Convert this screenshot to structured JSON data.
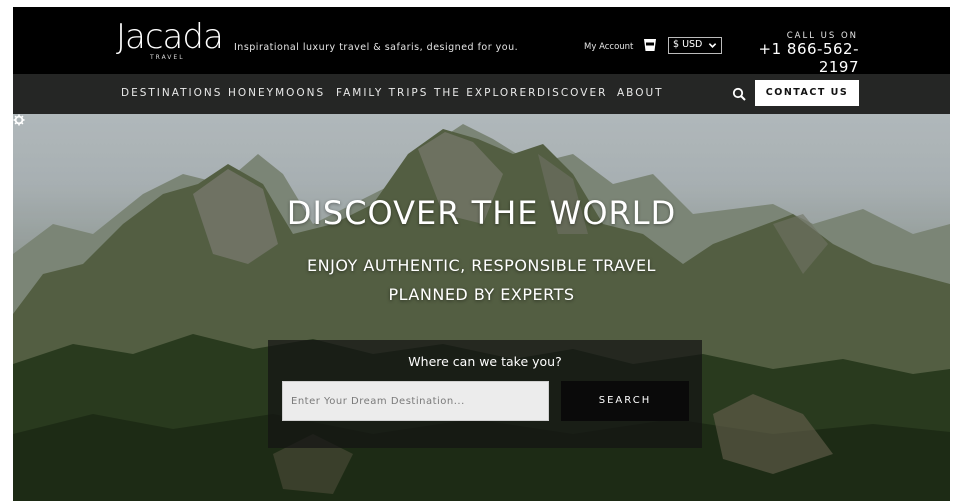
{
  "brand": {
    "logo_text": "Jacada",
    "logo_subtext": "TRAVEL",
    "tagline": "Inspirational luxury travel & safaris, designed for you."
  },
  "header": {
    "account_label": "My Account",
    "account_icon": "cup-icon",
    "currency": "$ USD",
    "call_label": "CALL US ON",
    "phone": "+1 866-562-2197"
  },
  "nav": {
    "items": [
      {
        "label": "DESTINATIONS"
      },
      {
        "label": "HONEYMOONS"
      },
      {
        "label": "FAMILY TRIPS"
      },
      {
        "label": "THE EXPLORER"
      },
      {
        "label": "DISCOVER"
      },
      {
        "label": "ABOUT"
      }
    ],
    "search_icon": "search-icon",
    "contact_label": "CONTACT US"
  },
  "hero": {
    "title": "DISCOVER THE WORLD",
    "subtitle_line1": "ENJOY AUTHENTIC, RESPONSIBLE TRAVEL",
    "subtitle_line2": "PLANNED BY EXPERTS",
    "search_title": "Where can we take you?",
    "search_placeholder": "Enter Your Dream Destination...",
    "search_button": "SEARCH"
  },
  "colors": {
    "topbar": "#000000",
    "navbar": "#282828",
    "contact_bg": "#ffffff",
    "search_button_bg": "#0a0a0a"
  }
}
